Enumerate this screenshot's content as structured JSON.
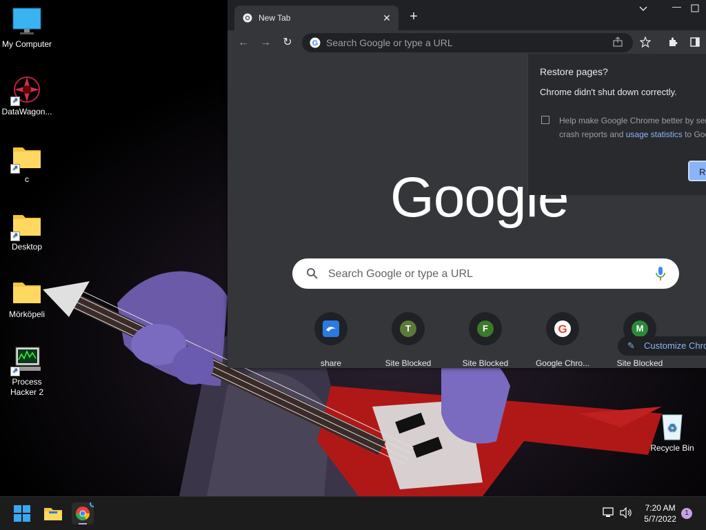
{
  "desktop": {
    "icons": [
      {
        "label": "My Computer"
      },
      {
        "label": "DataWagon..."
      },
      {
        "label": "c"
      },
      {
        "label": "Desktop"
      },
      {
        "label": "Mörköpeli"
      },
      {
        "label": "Process Hacker 2"
      },
      {
        "label": "Recycle Bin"
      }
    ]
  },
  "chrome": {
    "tab_title": "New Tab",
    "omnibox_placeholder": "Search Google or type a URL",
    "logo_text": "Google",
    "search_placeholder": "Search Google or type a URL",
    "shortcuts": [
      {
        "label": "share",
        "letter": ""
      },
      {
        "label": "Site Blocked",
        "letter": "T"
      },
      {
        "label": "Site Blocked",
        "letter": "F"
      },
      {
        "label": "Google Chro...",
        "letter": ""
      },
      {
        "label": "Site Blocked",
        "letter": "M"
      }
    ],
    "customize_label": "Customize Chro",
    "restore": {
      "heading": "Restore pages?",
      "message": "Chrome didn't shut down correctly.",
      "help_line1": "Help make Google Chrome better by ser",
      "help_line2_prefix": "crash reports and ",
      "help_link": "usage statistics",
      "help_line2_suffix": " to Goo",
      "button": "Re"
    }
  },
  "taskbar": {
    "time": "7:20 AM",
    "date": "5/7/2022",
    "notification_count": "1"
  },
  "colors": {
    "accent": "#8ab4f8",
    "window_bg": "#35363a",
    "titlebar_bg": "#202124",
    "taskbar_bg": "#1c1c1c"
  }
}
